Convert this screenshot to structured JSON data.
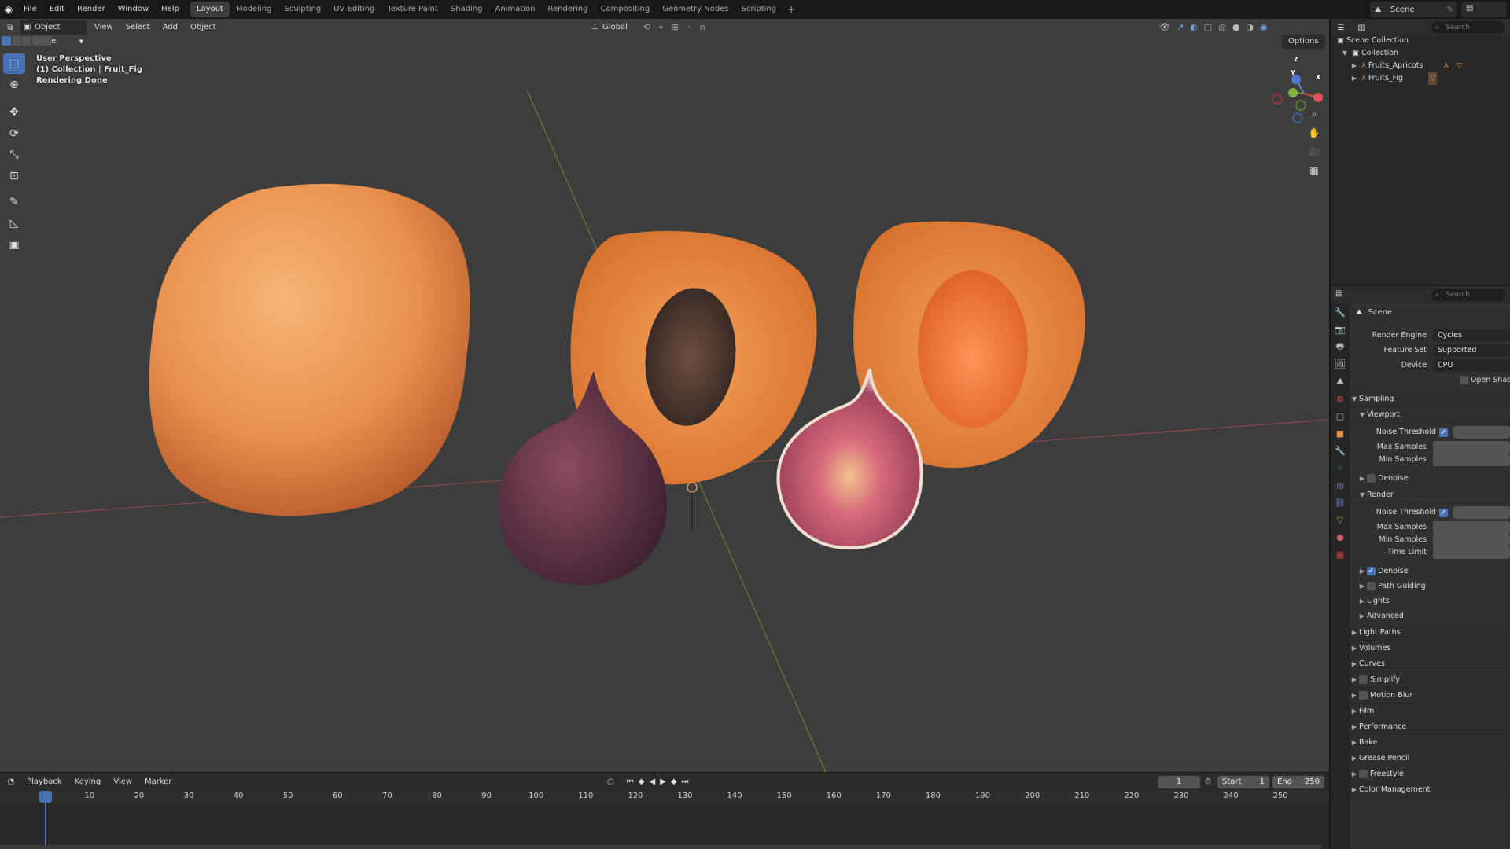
{
  "topbar": {
    "menus": [
      "File",
      "Edit",
      "Render",
      "Window",
      "Help"
    ],
    "workspaces": [
      "Layout",
      "Modeling",
      "Sculpting",
      "UV Editing",
      "Texture Paint",
      "Shading",
      "Animation",
      "Rendering",
      "Compositing",
      "Geometry Nodes",
      "Scripting"
    ],
    "active_workspace": "Layout",
    "scene_name": "Scene"
  },
  "viewport": {
    "header": {
      "mode": "Object Mode",
      "menus": [
        "View",
        "Select",
        "Add",
        "Object"
      ],
      "transform_orientation": "Global",
      "options_label": "Options"
    },
    "info": [
      "User Perspective",
      "(1) Collection | Fruit_Fig",
      "Rendering Done"
    ],
    "gizmo_axes": [
      "Z",
      "Y",
      "X"
    ]
  },
  "timeline": {
    "menus": [
      "Playback",
      "Keying",
      "View",
      "Marker"
    ],
    "current_frame": "1",
    "start_label": "Start",
    "start_value": "1",
    "end_label": "End",
    "end_value": "250",
    "ticks": [
      "1",
      "10",
      "20",
      "30",
      "40",
      "50",
      "60",
      "70",
      "80",
      "90",
      "100",
      "110",
      "120",
      "130",
      "140",
      "150",
      "160",
      "170",
      "180",
      "190",
      "200",
      "210",
      "220",
      "230",
      "240",
      "250"
    ]
  },
  "outliner": {
    "search_placeholder": "Search",
    "items": [
      {
        "label": "Scene Collection",
        "indent": 0
      },
      {
        "label": "Collection",
        "indent": 1
      },
      {
        "label": "Fruits_Apricots",
        "indent": 2
      },
      {
        "label": "Fruits_Fig",
        "indent": 2
      }
    ]
  },
  "properties": {
    "search_placeholder": "Search",
    "context": "Scene",
    "render_engine_label": "Render Engine",
    "render_engine": "Cycles",
    "feature_set_label": "Feature Set",
    "feature_set": "Supported",
    "device_label": "Device",
    "device": "CPU",
    "open_shading_label": "Open Shadin",
    "sampling": "Sampling",
    "viewport": "Viewport",
    "noise_threshold": "Noise Threshold",
    "max_samples": "Max Samples",
    "min_samples": "Min Samples",
    "denoise": "Denoise",
    "render": "Render",
    "time_limit": "Time Limit",
    "path_guiding": "Path Guiding",
    "lights": "Lights",
    "advanced": "Advanced",
    "sections": [
      "Light Paths",
      "Volumes",
      "Curves",
      "Simplify",
      "Motion Blur",
      "Film",
      "Performance",
      "Bake",
      "Grease Pencil",
      "Freestyle",
      "Color Management"
    ]
  }
}
